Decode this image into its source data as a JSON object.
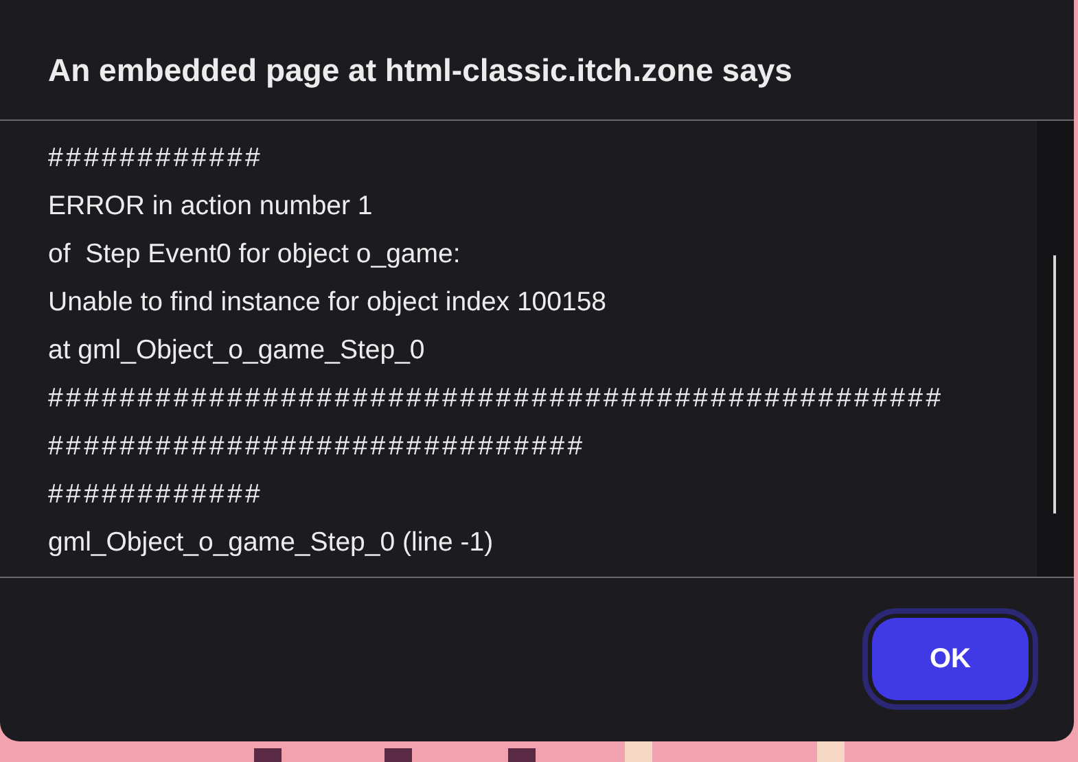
{
  "dialog": {
    "title": "An embedded page at html-classic.itch.zone says",
    "message_lines": [
      "############",
      "ERROR in action number 1",
      "of  Step Event0 for object o_game:",
      "Unable to find instance for object index 100158",
      "at gml_Object_o_game_Step_0",
      "##################################################",
      "##############################",
      "############",
      "gml_Object_o_game_Step_0 (line -1)"
    ],
    "buttons": [
      {
        "label": "OK",
        "selected": true
      }
    ]
  }
}
